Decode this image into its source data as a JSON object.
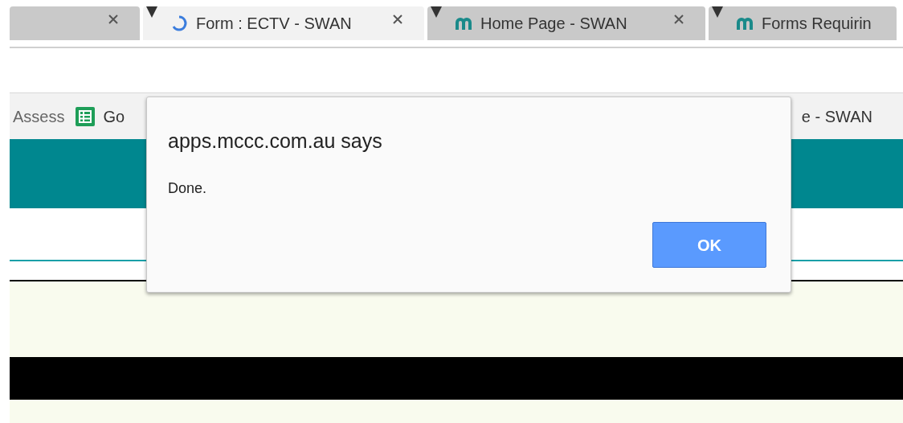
{
  "tabs": [
    {
      "kind": "partial",
      "selected": false
    },
    {
      "kind": "loading",
      "title": "Form : ECTV - SWAN",
      "selected": true
    },
    {
      "kind": "site",
      "title": "Home Page - SWAN",
      "selected": false
    },
    {
      "kind": "site",
      "title": "Forms Requirin",
      "selected": false
    }
  ],
  "bookmarks": [
    {
      "kind": "text",
      "label": "Assess"
    },
    {
      "kind": "sheet",
      "label": "Go"
    },
    {
      "kind": "text",
      "label": "e - SWAN"
    }
  ],
  "dialog": {
    "title": "apps.mccc.com.au says",
    "message": "Done.",
    "button": "OK"
  }
}
